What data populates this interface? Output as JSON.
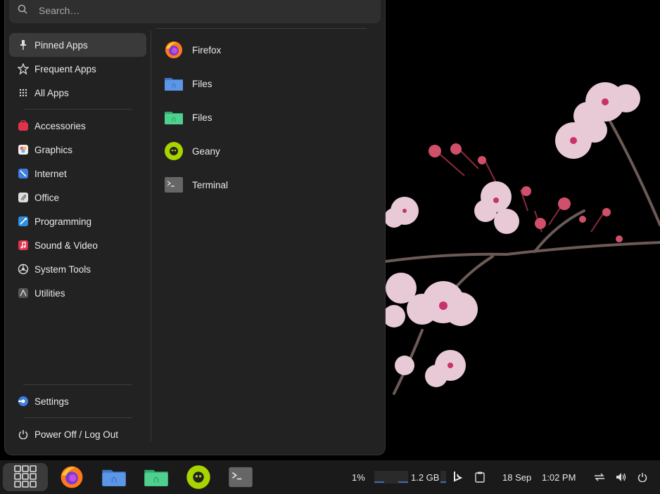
{
  "search": {
    "placeholder": "Search…"
  },
  "categories": [
    {
      "label": "Pinned Apps",
      "icon": "pin-icon"
    },
    {
      "label": "Frequent Apps",
      "icon": "star-icon"
    },
    {
      "label": "All Apps",
      "icon": "grid-icon"
    },
    {
      "label": "Accessories",
      "icon": "accessories-icon"
    },
    {
      "label": "Graphics",
      "icon": "graphics-icon"
    },
    {
      "label": "Internet",
      "icon": "internet-icon"
    },
    {
      "label": "Office",
      "icon": "office-icon"
    },
    {
      "label": "Programming",
      "icon": "programming-icon"
    },
    {
      "label": "Sound & Video",
      "icon": "sound-video-icon"
    },
    {
      "label": "System Tools",
      "icon": "system-tools-icon"
    },
    {
      "label": "Utilities",
      "icon": "utilities-icon"
    }
  ],
  "bottom": {
    "settings": "Settings",
    "power": "Power Off / Log Out"
  },
  "apps": [
    {
      "label": "Firefox",
      "icon": "firefox-icon"
    },
    {
      "label": "Files",
      "icon": "files-blue-icon"
    },
    {
      "label": "Files",
      "icon": "files-green-icon"
    },
    {
      "label": "Geany",
      "icon": "geany-icon"
    },
    {
      "label": "Terminal",
      "icon": "terminal-icon"
    }
  ],
  "taskbar": {
    "cpu": "1%",
    "memory": "1.2 GB",
    "date": "18 Sep",
    "time": "1:02 PM"
  },
  "colors": {
    "menu_bg": "#222222",
    "selected_bg": "#3a3a3a",
    "taskbar_bg": "#1a1a1a"
  }
}
